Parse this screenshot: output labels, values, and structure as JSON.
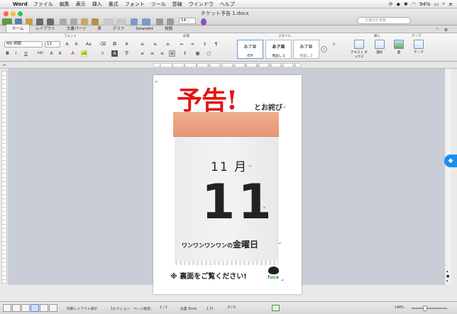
{
  "menubar": {
    "app": "Word",
    "items": [
      "ファイル",
      "編集",
      "表示",
      "挿入",
      "書式",
      "フォント",
      "ツール",
      "罫線",
      "ウインドウ",
      "ヘルプ"
    ],
    "battery": "94%"
  },
  "window": {
    "doc_title": "チケット予告 1.docx",
    "zoom_field": "14...",
    "search_placeholder": "文書内を検索"
  },
  "tabs": [
    "ホーム",
    "レイアウト",
    "文書パーツ",
    "表",
    "グラフ",
    "SmartArt",
    "校閲"
  ],
  "ribbon": {
    "groups": {
      "font": "フォント",
      "paragraph": "段落",
      "styles": "スタイル",
      "insert": "挿入",
      "theme": "テーマ"
    },
    "font_name": "MS 明朝",
    "font_size": "12",
    "styles": [
      {
        "preview": "あア亜",
        "label": "標準"
      },
      {
        "preview": "あア亜",
        "label": "見出し 1"
      },
      {
        "preview": "あア亜",
        "label": "見出し 2"
      }
    ],
    "insert_buttons": [
      "テキスト ボックス",
      "図形",
      "図"
    ],
    "theme_button": "テーマ"
  },
  "ruler": {
    "ticks": [
      "2",
      "4",
      "6",
      "8",
      "10",
      "12",
      "14",
      "16",
      "18",
      "20",
      "22",
      "24"
    ]
  },
  "document": {
    "headline": "予告!",
    "subline": "とお詫び",
    "month": "11 月",
    "day": "11",
    "weekday_prefix": "ワンワンワンワンの",
    "weekday": "金曜日",
    "footer": "※ 裏面をご覧ください!",
    "logo_text": "fuca"
  },
  "status": {
    "view_label": "印刷レイアウト表示",
    "section": "1セクション",
    "page_label": "ページ指定:",
    "page_value": "1 / 1",
    "position_label": "位置 0mm",
    "line": "1 行",
    "words": "0 / 0",
    "zoom": "148%"
  }
}
